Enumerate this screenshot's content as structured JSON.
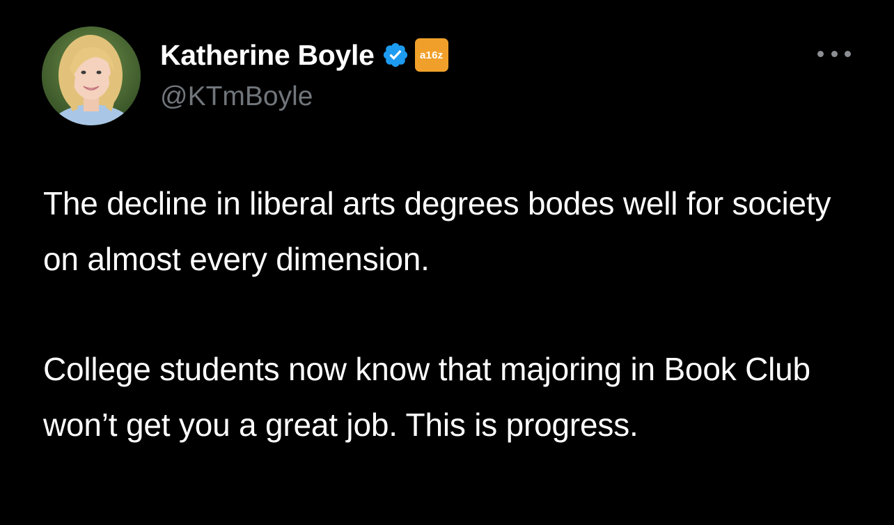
{
  "author": {
    "display_name": "Katherine Boyle",
    "handle": "@KTmBoyle",
    "verified": true,
    "verified_icon": "verified-badge-icon",
    "affiliation_badge": "a16z",
    "affiliation_color": "#f0a02a",
    "verified_color": "#1d9bf0"
  },
  "tweet": {
    "paragraphs": [
      "The decline in liberal arts degrees bodes well for society on almost every dimension.",
      "College students now know that majoring in Book Club won’t get you a great job. This is progress."
    ]
  },
  "menu": {
    "icon": "more-options-icon"
  },
  "colors": {
    "background": "#000000",
    "text_primary": "#ffffff",
    "text_secondary": "#71767b"
  }
}
